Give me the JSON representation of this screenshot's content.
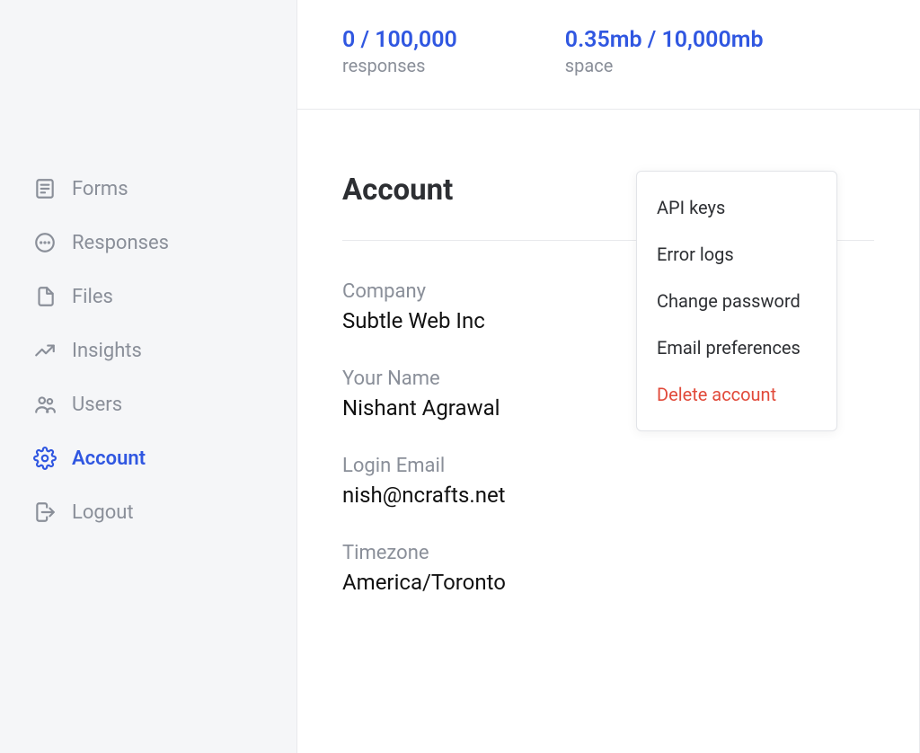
{
  "sidebar": {
    "items": [
      {
        "label": "Forms",
        "icon": "form-icon"
      },
      {
        "label": "Responses",
        "icon": "chat-icon"
      },
      {
        "label": "Files",
        "icon": "files-icon"
      },
      {
        "label": "Insights",
        "icon": "insights-icon"
      },
      {
        "label": "Users",
        "icon": "users-icon"
      },
      {
        "label": "Account",
        "icon": "gear-icon"
      },
      {
        "label": "Logout",
        "icon": "logout-icon"
      }
    ],
    "active_index": 5
  },
  "topbar": {
    "responses": {
      "value": "0 / 100,000",
      "label": "responses"
    },
    "space": {
      "value": "0.35mb / 10,000mb",
      "label": "space"
    }
  },
  "page": {
    "title": "Account",
    "fields": {
      "company": {
        "label": "Company",
        "value": "Subtle Web Inc"
      },
      "name": {
        "label": "Your Name",
        "value": "Nishant Agrawal"
      },
      "email": {
        "label": "Login Email",
        "value": "nish@ncrafts.net"
      },
      "timezone": {
        "label": "Timezone",
        "value": "America/Toronto"
      }
    }
  },
  "dropdown": {
    "items": [
      {
        "label": "API keys",
        "danger": false
      },
      {
        "label": "Error logs",
        "danger": false
      },
      {
        "label": "Change password",
        "danger": false
      },
      {
        "label": "Email preferences",
        "danger": false
      },
      {
        "label": "Delete account",
        "danger": true
      }
    ]
  }
}
